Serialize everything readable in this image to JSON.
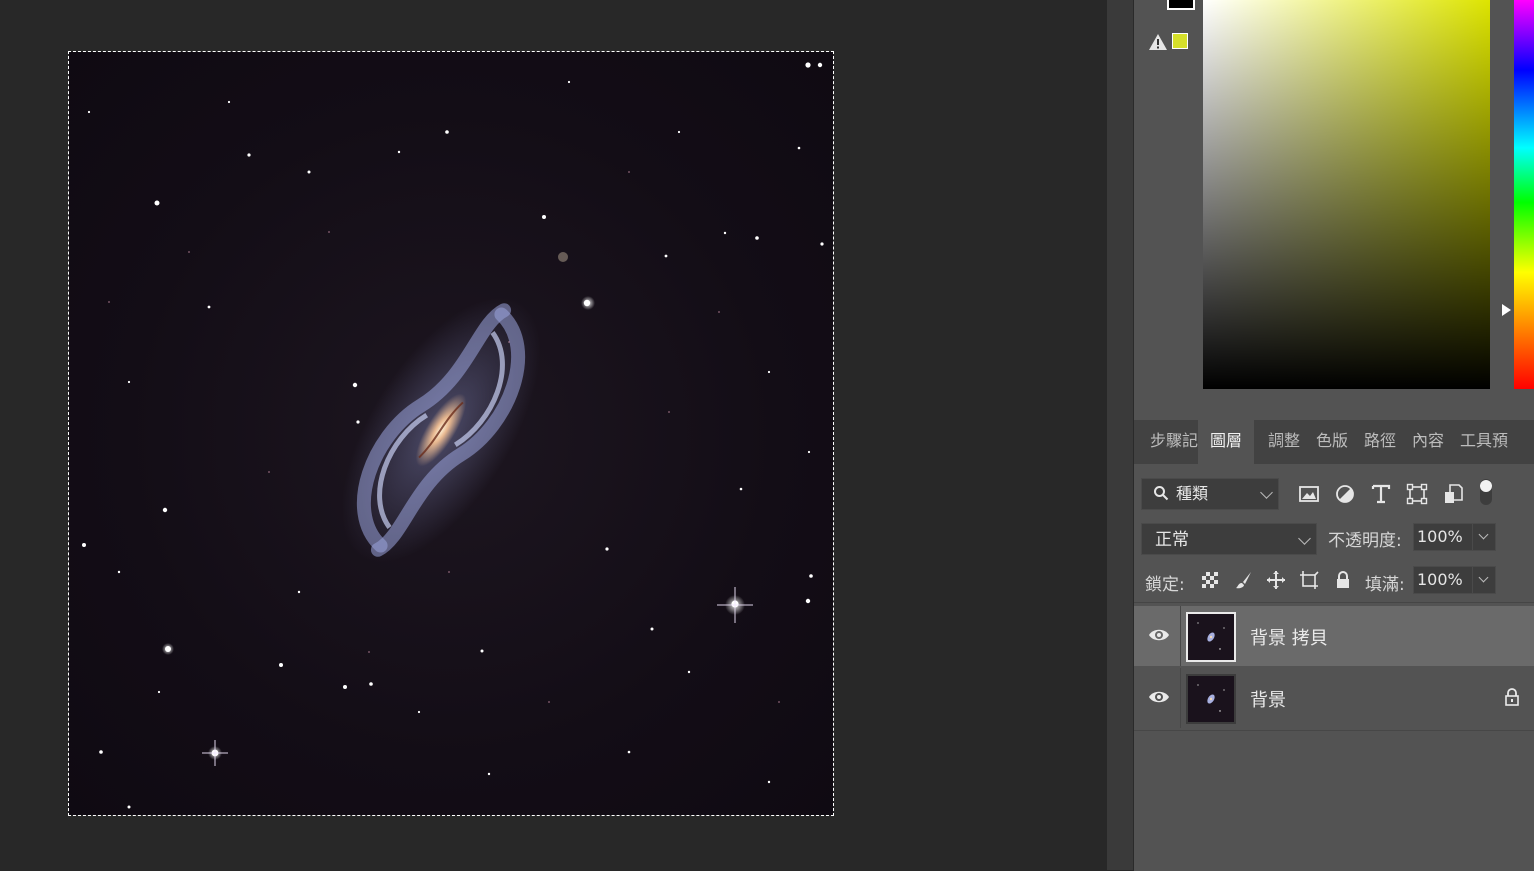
{
  "canvas": {
    "image_subject": "barred-spiral-galaxy-starfield"
  },
  "color_picker": {
    "foreground_color": "#000000",
    "gamut_warning_color": "#d6e02a",
    "field_hue": "#dde400"
  },
  "panel_tabs": [
    {
      "label": "步驟記",
      "active": false
    },
    {
      "label": "圖層",
      "active": true
    },
    {
      "label": "調整",
      "active": false
    },
    {
      "label": "色版",
      "active": false
    },
    {
      "label": "路徑",
      "active": false
    },
    {
      "label": "內容",
      "active": false
    },
    {
      "label": "工具預",
      "active": false
    }
  ],
  "layers_panel": {
    "filter_kind": "種類",
    "blend_mode": "正常",
    "opacity_label": "不透明度:",
    "opacity_value": "100%",
    "lock_label": "鎖定:",
    "fill_label": "填滿:",
    "fill_value": "100%",
    "layers": [
      {
        "name": "背景 拷貝",
        "visible": true,
        "selected": true,
        "locked": false
      },
      {
        "name": "背景",
        "visible": true,
        "selected": false,
        "locked": true
      }
    ]
  },
  "icons": {
    "filter_icons": [
      "image-filter-icon",
      "adjustment-filter-icon",
      "type-filter-icon",
      "shape-filter-icon",
      "smart-object-filter-icon",
      "filter-toggle-icon"
    ],
    "lock_icons": [
      "lock-transparent-pixels-icon",
      "lock-image-pixels-icon",
      "lock-position-icon",
      "lock-artboard-icon",
      "lock-all-icon"
    ]
  }
}
